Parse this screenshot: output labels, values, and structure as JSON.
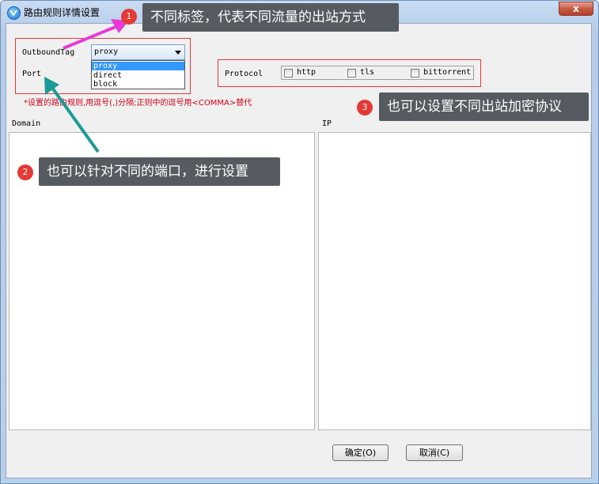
{
  "window": {
    "title": "路由规则详情设置",
    "close_label": "x"
  },
  "form": {
    "outbound_tag_label": "OutboundTag",
    "outbound_tag_value": "proxy",
    "outbound_options": [
      "proxy",
      "direct",
      "block"
    ],
    "port_label": "Port",
    "protocol_label": "Protocol",
    "protocols": [
      "http",
      "tls",
      "bittorrent"
    ],
    "hint": "*设置的路由规则,用逗号(,)分隔;正则中的逗号用<COMMA>替代"
  },
  "panels": {
    "domain_label": "Domain",
    "ip_label": "IP"
  },
  "buttons": {
    "ok": "确定(O)",
    "cancel": "取消(C)"
  },
  "annotations": [
    {
      "number": "1",
      "text": "不同标签，代表不同流量的出站方式"
    },
    {
      "number": "2",
      "text": "也可以针对不同的端口，进行设置"
    },
    {
      "number": "3",
      "text": "也可以设置不同出站加密协议"
    }
  ],
  "colors": {
    "annotation_red": "#e53935",
    "arrow_magenta": "#e63bd6",
    "arrow_teal": "#1b9a96"
  }
}
